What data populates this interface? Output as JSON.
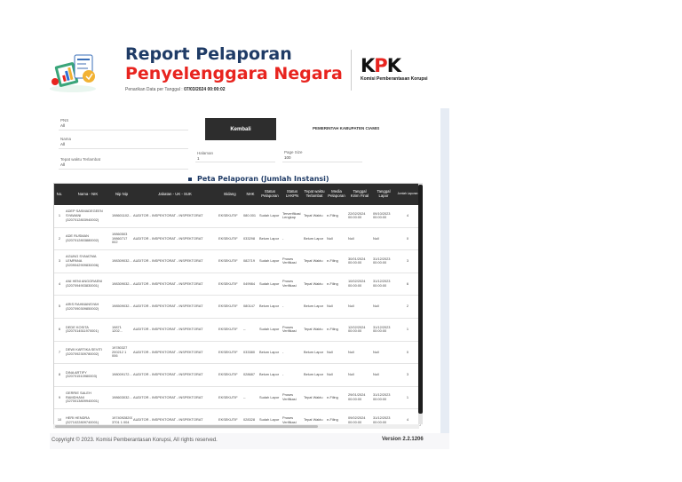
{
  "header": {
    "title_line1": "Report Pelaporan",
    "title_line2": "Penyelenggara Negara",
    "generated_label": "Penarikan Data per Tanggal :",
    "generated_value": "07/03/2024 00:00:02",
    "logo_text_k": "K",
    "logo_text_p": "P",
    "logo_text_k2": "K",
    "logo_subtitle": "Komisi Pemberantasan Korupsi"
  },
  "filters": {
    "pns_label": "PNS",
    "pns_value": "All",
    "nama_label": "Nama",
    "nama_value": "All",
    "tepat_label": "Tepat waktu Terlambat",
    "tepat_value": "All",
    "kembali_button": "Kembali",
    "pemda_label": "PEMERINTAH KABUPATEN CIAMIS",
    "halaman_label": "Halaman",
    "halaman_value": "1",
    "pagesize_label": "Page Size",
    "pagesize_value": "100"
  },
  "section_title": "Peta Pelaporan (Jumlah Instansi)",
  "table": {
    "headers": [
      "No.",
      "Nama - NIK",
      "Nip Nip",
      "Jabatan - UK - SUK",
      "Bidang",
      "NHK",
      "Status Pelaporan",
      "Status LHKPN",
      "Tepat waktu Terlambat",
      "Media Pelaporan",
      "Tanggal Kirim Final",
      "Tanggal Lapor",
      "Jumlah Laporan"
    ],
    "rows": [
      [
        "1",
        "ADEP SASMADEGEEN SYAWANI (3207012803940002)",
        "198601102...",
        "AUDITOR - INSPEKTORAT - INSPEKTORAT",
        "EKSEKUTIF",
        "080.001",
        "Sudah Lapor",
        "Terverifikasi Lengkap",
        "Tepat Waktu",
        "e-Filing",
        "22/02/2024 00:00:00",
        "09/10/2023 00:00:00",
        "4"
      ],
      [
        "2",
        "ADE RUSMAN (3207012803880002)",
        "19860503 19860717 002",
        "AUDITOR - INSPEKTORAT - INSPEKTORAT",
        "EKSEKUTIF",
        "033298",
        "Belum Lapor",
        "-",
        "Belum Lapor",
        "Null",
        "Null",
        "Null",
        "0"
      ],
      [
        "3",
        "AGUNG SYAIATMA LEMPANA (3209042909830006)",
        "198309032...",
        "AUDITOR - INSPEKTORAT - INSPEKTORAT",
        "EKSEKUTIF",
        "082719",
        "Sudah Lapor",
        "Proses Verifikasi",
        "Tepat Waktu",
        "e-Filing",
        "30/01/2024 00:00:00",
        "31/12/2023 00:00:00",
        "3"
      ],
      [
        "4",
        "ANI HENI ANGGRAENI (3207094903830001)",
        "198309032...",
        "AUDITOR - INSPEKTORAT - INSPEKTORAT",
        "EKSEKUTIF",
        "049984",
        "Sudah Lapor",
        "Proses Verifikasi",
        "Tepat Waktu",
        "e-Filing",
        "10/02/2024 00:00:00",
        "31/12/2023 00:00:00",
        "6"
      ],
      [
        "5",
        "ARIS RAHMANSYAH (3207090309850002)",
        "198509032...",
        "AUDITOR - INSPEKTORAT - INSPEKTORAT",
        "EKSEKUTIF",
        "080147",
        "Belum Lapor",
        "-",
        "Belum Lapor",
        "Null",
        "Null",
        "Null",
        "2"
      ],
      [
        "6",
        "DEDE KOSITA (3207014511970001)",
        "19871 1202...",
        "AUDITOR - INSPEKTORAT - INSPEKTORAT",
        "EKSEKUTIF",
        "--",
        "Sudah Lapor",
        "Proses Verifikasi",
        "Tepat Waktu",
        "e-Filing",
        "12/02/2024 00:00:00",
        "31/12/2023 00:00:00",
        "1"
      ],
      [
        "7",
        "DEWI KARTIKA SEVITI (3207092309780002)",
        "19780327 200212 1 006",
        "AUDITOR - INSPEKTORAT - INSPEKTORAT",
        "EKSEKUTIF",
        "033380",
        "Belum Lapor",
        "-",
        "Belum Lapor",
        "Null",
        "Null",
        "Null",
        "0"
      ],
      [
        "8",
        "DINA ARTIFY (320701510980003)",
        "198009172...",
        "AUDITOR - INSPEKTORAT - INSPEKTORAT",
        "EKSEKUTIF",
        "028687",
        "Belum Lapor",
        "-",
        "Belum Lapor",
        "Null",
        "Null",
        "Null",
        "3"
      ],
      [
        "9",
        "GERRIE SALEH RAMDHANI (3270013809940001)",
        "198603032...",
        "AUDITOR - INSPEKTORAT - INSPEKTORAT",
        "EKSEKUTIF",
        "--",
        "Sudah Lapor",
        "Proses Verifikasi",
        "Tepat Waktu",
        "e-Filing",
        "29/01/2024 00:00:00",
        "31/12/2023 00:00:00",
        "1"
      ],
      [
        "10",
        "HERI HENDRA (3271022809740001)",
        "19740928200 3701 1 004",
        "AUDITOR - INSPEKTORAT - INSPEKTORAT",
        "EKSEKUTIF",
        "028328",
        "Sudah Lapor",
        "Proses Verifikasi",
        "Tepat Waktu",
        "e-Filing",
        "09/02/2024 00:00:00",
        "31/12/2023 00:00:00",
        "4"
      ]
    ]
  },
  "footer": {
    "copyright": "Copyright © 2023. Komisi Pemberantasan Korupsi, All rights reserved.",
    "version": "Version  2.2.1206"
  }
}
